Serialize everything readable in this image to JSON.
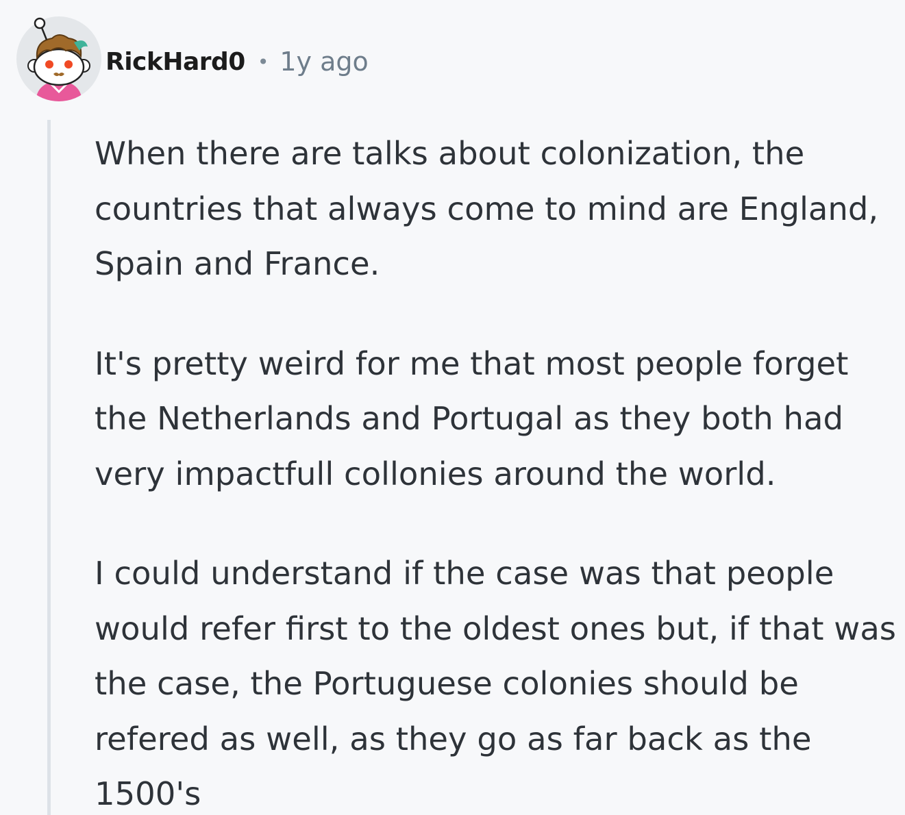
{
  "comment": {
    "username": "RickHard0",
    "separator": "•",
    "timestamp": "1y ago",
    "paragraphs": [
      "When there are talks about colonization, the countries that always come to mind are England, Spain and France.",
      "It's pretty weird for me that most people forget the Netherlands and Portugal as they both had very impactfull collonies around the world.",
      "I could understand if the case was that people would refer first to the oldest ones but, if that was the case, the Portuguese colonies should be refered as well, as they go as far back as the 1500's"
    ],
    "avatar": {
      "icon": "reddit-snoo-avatar-icon",
      "colors": {
        "background": "#e4e7ea",
        "hair": "#a06a2a",
        "accent": "#3fb39a",
        "shirt": "#e8599a",
        "eyes": "#f04a24"
      }
    }
  },
  "colors": {
    "page_background": "#f7f8fa",
    "text": "#2e3339",
    "username": "#1c1c1c",
    "timestamp": "#6e7d8b",
    "thread_line": "#dde2e8"
  }
}
